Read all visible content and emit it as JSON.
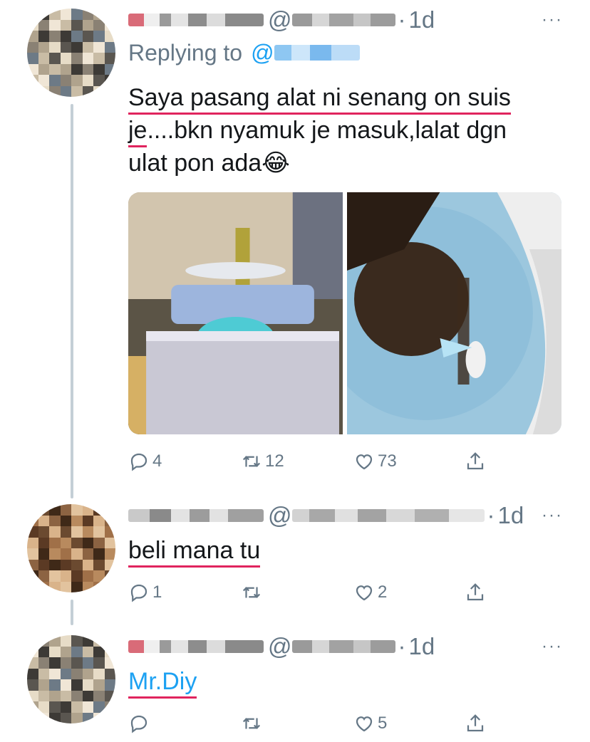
{
  "tweets": [
    {
      "time": "1d",
      "replying_to_label": "Replying to",
      "text_line1": "Saya pasang alat ni senang on suis",
      "text_je": "je",
      "text_line2_rest": "....bkn nyamuk je masuk,lalat dgn",
      "text_line3": "ulat pon ada",
      "emoji": "😂",
      "reply_count": "4",
      "retweet_count": "12",
      "like_count": "73"
    },
    {
      "time": "1d",
      "text": "beli mana tu",
      "reply_count": "1",
      "retweet_count": "",
      "like_count": "2"
    },
    {
      "time": "1d",
      "text": "Mr.Diy",
      "reply_count": "",
      "retweet_count": "",
      "like_count": "5"
    }
  ],
  "common": {
    "at": "@",
    "dot": "·",
    "more": "···"
  },
  "icons": {
    "reply": "reply-icon",
    "retweet": "retweet-icon",
    "like": "heart-icon",
    "share": "share-icon",
    "more": "more-icon"
  },
  "colors": {
    "text": "#14171a",
    "secondary": "#657786",
    "link": "#1da1f2",
    "underline": "#e0245e",
    "thread_line": "#c4cfd6"
  }
}
